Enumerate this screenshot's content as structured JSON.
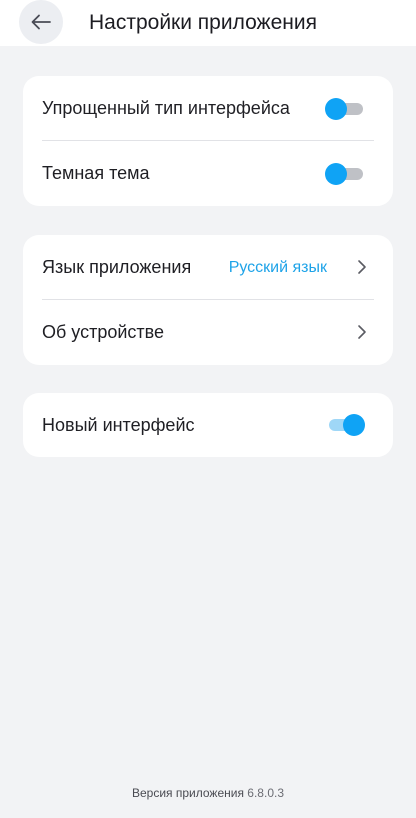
{
  "header": {
    "title": "Настройки приложения",
    "back_icon": "arrow-left-icon"
  },
  "cards": [
    {
      "rows": [
        {
          "label": "Упрощенный тип интерфейса",
          "control": "toggle",
          "on": false
        },
        {
          "label": "Темная тема",
          "control": "toggle",
          "on": false
        }
      ]
    },
    {
      "rows": [
        {
          "label": "Язык приложения",
          "value": "Русский язык",
          "control": "chevron-right-icon"
        },
        {
          "label": "Об устройстве",
          "control": "chevron-right-icon"
        }
      ]
    },
    {
      "rows": [
        {
          "label": "Новый интерфейс",
          "control": "toggle",
          "on": true
        }
      ]
    }
  ],
  "footer": {
    "version_label": "Версия приложения",
    "version_number": "6.8.0.3"
  },
  "colors": {
    "accent": "#0fa3f5",
    "link": "#1ea3e8",
    "background": "#f2f3f5",
    "card": "#ffffff"
  }
}
